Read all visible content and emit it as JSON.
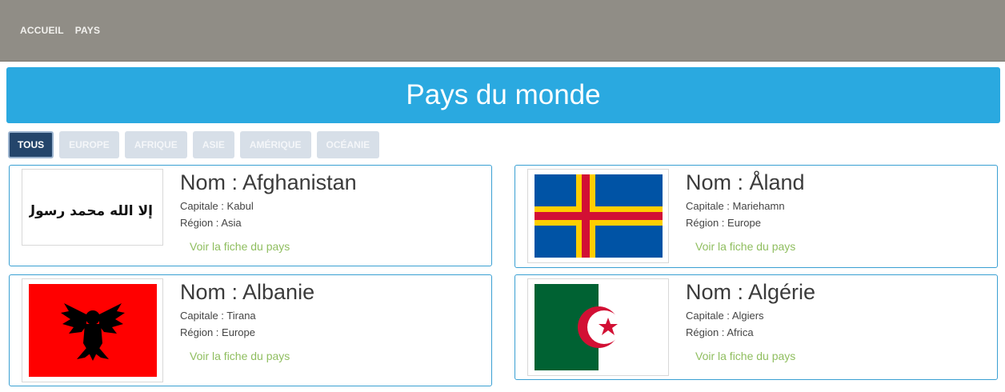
{
  "nav": {
    "items": [
      {
        "label": "ACCUEIL"
      },
      {
        "label": "PAYS"
      }
    ]
  },
  "banner": {
    "title": "Pays du monde"
  },
  "filters": [
    {
      "label": "TOUS",
      "active": true
    },
    {
      "label": "EUROPE"
    },
    {
      "label": "AFRIQUE"
    },
    {
      "label": "ASIE"
    },
    {
      "label": "AMÉRIQUE"
    },
    {
      "label": "OCÉANIE"
    }
  ],
  "countries": [
    {
      "name": "Nom : Afghanistan",
      "capital": "Capitale : Kabul",
      "region": "Région : Asia",
      "link": "Voir la fiche du pays",
      "flag": "afghanistan-flag",
      "flag_text": "لا إله إلا الله محمد رسول الله"
    },
    {
      "name": "Nom : Åland",
      "capital": "Capitale : Mariehamn",
      "region": "Région : Europe",
      "link": "Voir la fiche du pays",
      "flag": "aland-flag"
    },
    {
      "name": "Nom : Albanie",
      "capital": "Capitale : Tirana",
      "region": "Région : Europe",
      "link": "Voir la fiche du pays",
      "flag": "albania-flag"
    },
    {
      "name": "Nom : Algérie",
      "capital": "Capitale : Algiers",
      "region": "Région : Africa",
      "link": "Voir la fiche du pays",
      "flag": "algeria-flag"
    }
  ],
  "colors": {
    "nav_bg": "#908d86",
    "banner_bg": "#2aa9e0",
    "active_filter": "#24456b",
    "link": "#8fbe5f",
    "card_border": "#3aa0d3"
  }
}
